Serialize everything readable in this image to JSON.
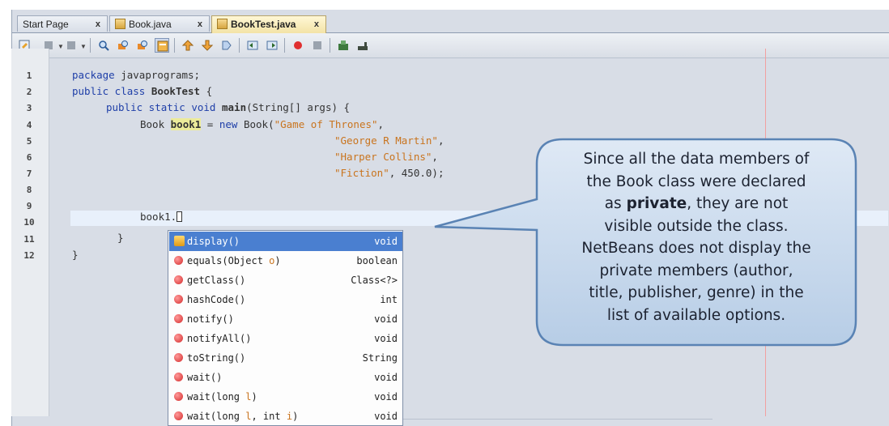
{
  "tabs": [
    {
      "label": "Start Page",
      "close": "x",
      "active": false
    },
    {
      "label": "Book.java",
      "close": "x",
      "active": false
    },
    {
      "label": "BookTest.java",
      "close": "x",
      "active": true
    }
  ],
  "toolbar": {
    "icons": [
      "last-edit-icon",
      "back-icon",
      "forward-icon",
      "find-previous-icon",
      "find-next-icon",
      "find-selection-icon",
      "toggle-highlight-icon",
      "previous-bookmark-icon",
      "next-bookmark-icon",
      "toggle-bookmark-icon",
      "shift-left-icon",
      "shift-right-icon",
      "start-macro-icon",
      "stop-macro-icon",
      "comment-icon",
      "uncomment-icon"
    ]
  },
  "line_numbers": [
    "1",
    "2",
    "3",
    "4",
    "5",
    "6",
    "7",
    "8",
    "9",
    "10",
    "11",
    "12"
  ],
  "code": {
    "l1_kw": "package",
    "l1_rest": " javaprograms;",
    "l2_kw": "public class",
    "l2_name": " BookTest",
    "l2_rest": " {",
    "l3_kw": "public static void",
    "l3_name": " main",
    "l3_rest": "(String[] args) {",
    "l4_a": "Book ",
    "l4_var": "book1",
    "l4_b": " = ",
    "l4_kw": "new",
    "l4_c": " Book(",
    "l4_str": "\"Game of Thrones\"",
    "l4_d": ",",
    "l5_str": "\"George R Martin\"",
    "l5_d": ",",
    "l6_str": "\"Harper Collins\"",
    "l6_d": ",",
    "l7_str": "\"Fiction\"",
    "l7_d": ", 450.0);",
    "l9": "book1.",
    "l10": "}",
    "l11": "}"
  },
  "completion": [
    {
      "name": "display()",
      "ret": "void",
      "selected": true
    },
    {
      "name": "equals(Object ",
      "param": "o",
      "tail": ")",
      "ret": "boolean"
    },
    {
      "name": "getClass()",
      "ret": "Class<?>"
    },
    {
      "name": "hashCode()",
      "ret": "int"
    },
    {
      "name": "notify()",
      "ret": "void"
    },
    {
      "name": "notifyAll()",
      "ret": "void"
    },
    {
      "name": "toString()",
      "ret": "String"
    },
    {
      "name": "wait()",
      "ret": "void"
    },
    {
      "name": "wait(long ",
      "param": "l",
      "tail": ")",
      "ret": "void"
    },
    {
      "name": "wait(long ",
      "param": "l",
      "tail": ", int ",
      "param2": "i",
      "tail2": ")",
      "ret": "void"
    }
  ],
  "callout": {
    "t1": "Since all the data members of",
    "t2": "the Book class were declared",
    "t3a": "as ",
    "t3b": "private",
    "t3c": ", they are not",
    "t4": "visible outside the class.",
    "t5": "NetBeans does not display the",
    "t6": "private members (author,",
    "t7": "title, publisher, genre) in the",
    "t8": "list of available options."
  }
}
